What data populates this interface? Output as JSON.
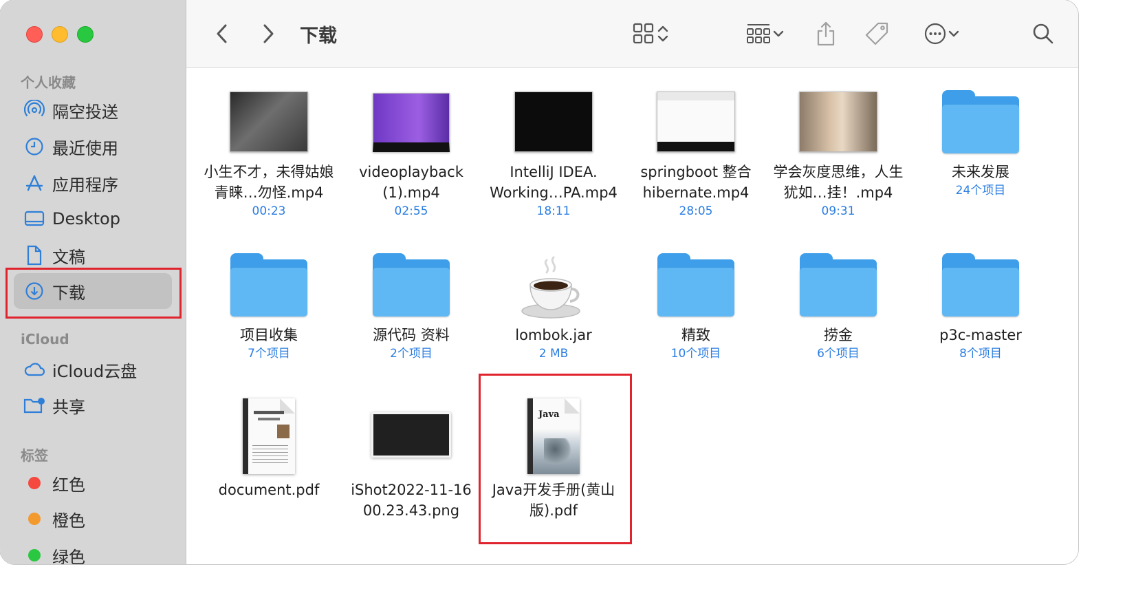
{
  "window": {
    "title": "下载"
  },
  "sidebar": {
    "favorites_title": "个人收藏",
    "favorites": [
      {
        "label": "隔空投送",
        "icon": "airdrop-icon"
      },
      {
        "label": "最近使用",
        "icon": "clock-icon"
      },
      {
        "label": "应用程序",
        "icon": "applications-icon"
      },
      {
        "label": "Desktop",
        "icon": "desktop-icon"
      },
      {
        "label": "文稿",
        "icon": "document-icon"
      },
      {
        "label": "下载",
        "icon": "download-icon"
      }
    ],
    "icloud_title": "iCloud",
    "icloud": [
      {
        "label": "iCloud云盘",
        "icon": "cloud-icon"
      },
      {
        "label": "共享",
        "icon": "shared-folder-icon"
      }
    ],
    "tags_title": "标签",
    "tags": [
      {
        "label": "红色",
        "color": "#f5483f"
      },
      {
        "label": "橙色",
        "color": "#f39a2e"
      },
      {
        "label": "绿色",
        "color": "#2ac840"
      }
    ]
  },
  "files": [
    {
      "name": "小生不才，未得姑娘青睐…勿怪.mp4",
      "sub": "00:23",
      "kind": "video"
    },
    {
      "name": "videoplayback (1).mp4",
      "sub": "02:55",
      "kind": "video"
    },
    {
      "name": "IntelliJ IDEA. Working…PA.mp4",
      "sub": "18:11",
      "kind": "video"
    },
    {
      "name": "springboot 整合 hibernate.mp4",
      "sub": "28:05",
      "kind": "video"
    },
    {
      "name": "学会灰度思维，人生犹如…挂！.mp4",
      "sub": "09:31",
      "kind": "video"
    },
    {
      "name": "未来发展",
      "sub": "24个项目",
      "kind": "folder"
    },
    {
      "name": "项目收集",
      "sub": "7个项目",
      "kind": "folder"
    },
    {
      "name": "源代码 资料",
      "sub": "2个项目",
      "kind": "folder"
    },
    {
      "name": "lombok.jar",
      "sub": "2 MB",
      "kind": "jar"
    },
    {
      "name": "精致",
      "sub": "10个项目",
      "kind": "folder"
    },
    {
      "name": "捞金",
      "sub": "6个项目",
      "kind": "folder"
    },
    {
      "name": "p3c-master",
      "sub": "8个项目",
      "kind": "folder"
    },
    {
      "name": "document.pdf",
      "sub": "",
      "kind": "pdf"
    },
    {
      "name": "iShot2022-11-16 00.23.43.png",
      "sub": "",
      "kind": "image"
    },
    {
      "name": "Java开发手册(黄山版).pdf",
      "sub": "",
      "kind": "pdf"
    }
  ]
}
